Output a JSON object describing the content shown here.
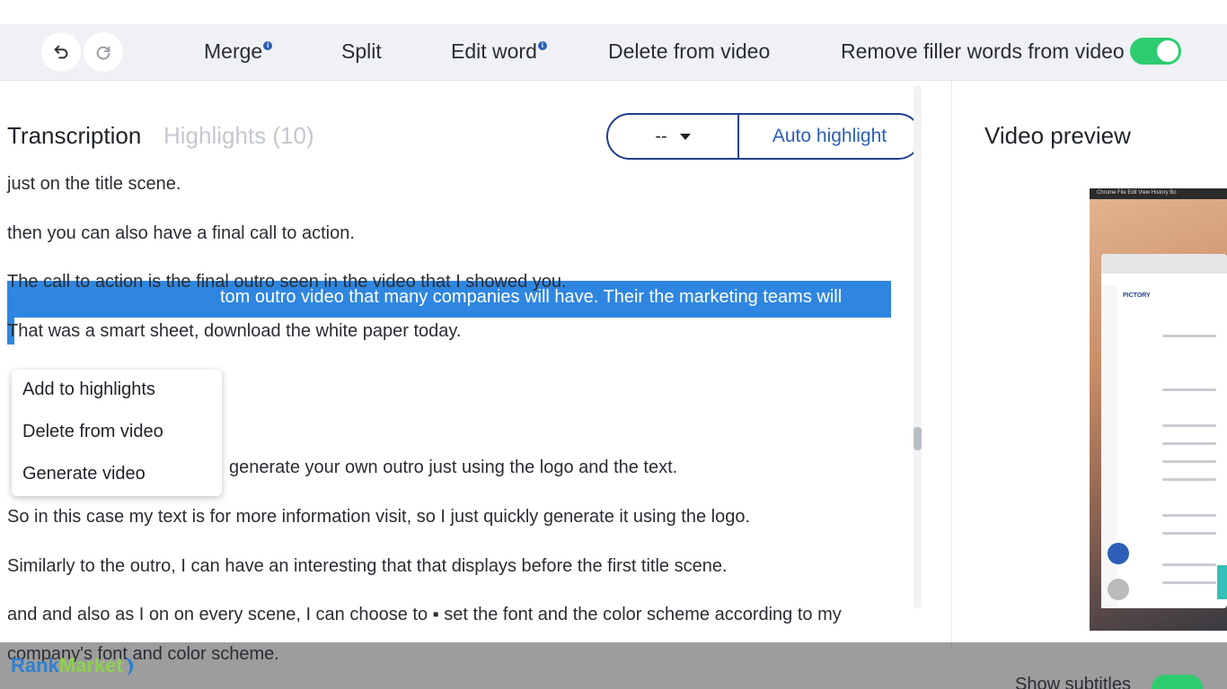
{
  "toolbar": {
    "undo_icon": "undo-icon",
    "redo_icon": "redo-icon",
    "merge": "Merge",
    "split": "Split",
    "edit_word": "Edit word",
    "delete_from_video": "Delete from video",
    "remove_filler": "Remove filler words from video",
    "info_badge": "i",
    "remove_filler_enabled": true,
    "toggle_color": "#2ecc71"
  },
  "tabs": {
    "transcription": "Transcription",
    "highlights": "Highlights (10)"
  },
  "highlight_controls": {
    "select_value": "--",
    "auto_highlight": "Auto highlight"
  },
  "transcript": {
    "lines": [
      "just on the title scene.",
      "then you can also have a final call to action.",
      "The call to action is the final outro seen in the video that I showed you.",
      "That was a smart sheet, download the white paper today.",
      "tom outro video that many companies will have. Their the marketing teams will",
      "generate your own outro just using the logo and the text.",
      "So in this case my text is for more information visit, so I just quickly generate it using the logo.",
      "Similarly to the outro, I can have an interesting that that displays before the first title scene.",
      "and and also as I on on every scene, I can choose to ▪ set the font and the color scheme according to my",
      "company's font and color scheme."
    ],
    "selection_color": "#2f86e0"
  },
  "context_menu": {
    "items": [
      "Add to highlights",
      "Delete from video",
      "Generate video"
    ]
  },
  "video_preview": {
    "title": "Video preview",
    "brand": "PICTORY",
    "desktop_bar": "Chrome  File  Edit  View  History  Bo"
  },
  "footer": {
    "show_subtitles": "Show subtitles",
    "show_subtitles_enabled": true,
    "watermark_rank": "Rank",
    "watermark_market": "Market"
  }
}
